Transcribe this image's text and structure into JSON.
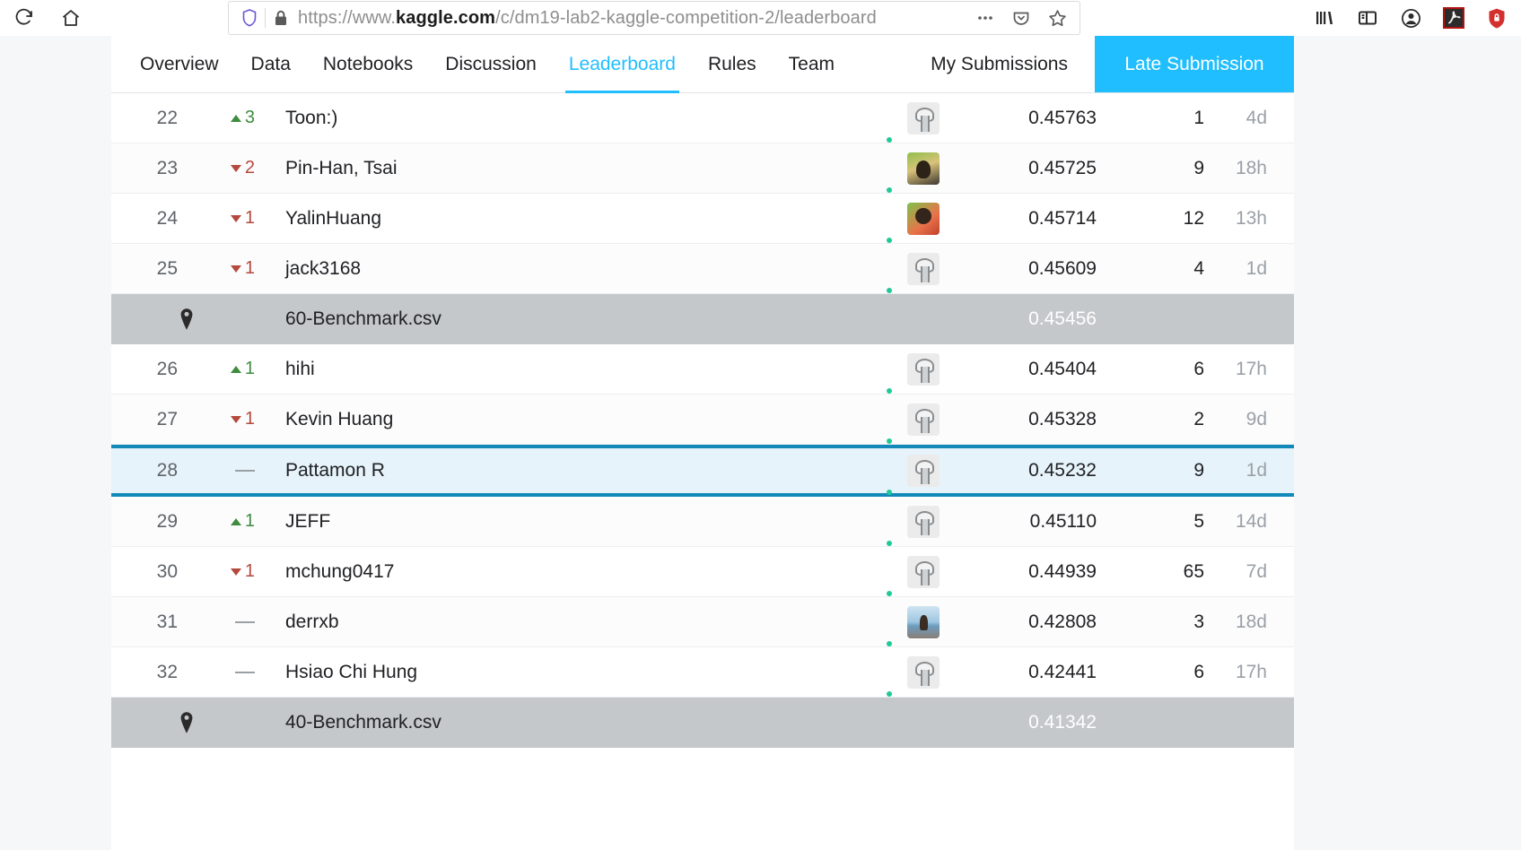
{
  "browser": {
    "reload_icon": "reload-icon",
    "home_icon": "home-icon",
    "shield_icon": "shield-icon",
    "lock_icon": "lock-icon",
    "url_scheme": "https://www.",
    "url_host": "kaggle.com",
    "url_path": "/c/dm19-lab2-kaggle-competition-2/leaderboard",
    "url_full": "https://www.kaggle.com/c/dm19-lab2-kaggle-competition-2/leaderboard",
    "page_actions_icon": "ellipsis-icon",
    "pocket_icon": "pocket-icon",
    "bookmark_icon": "star-icon",
    "toolbar_icons": [
      "library-icon",
      "sidebar-icon",
      "account-icon",
      "adobe-acrobat-icon",
      "shield-extension-icon"
    ]
  },
  "nav": {
    "tabs": [
      {
        "label": "Overview",
        "active": false
      },
      {
        "label": "Data",
        "active": false
      },
      {
        "label": "Notebooks",
        "active": false
      },
      {
        "label": "Discussion",
        "active": false
      },
      {
        "label": "Leaderboard",
        "active": true
      },
      {
        "label": "Rules",
        "active": false
      },
      {
        "label": "Team",
        "active": false
      }
    ],
    "my_submissions": "My Submissions",
    "late_submission": "Late Submission",
    "accent_color": "#20beff"
  },
  "leaderboard": {
    "highlight_border_color": "#1389ba",
    "highlight_bg_color": "#e6f3fa",
    "benchmark_bg_color": "#c4c8cb",
    "pin_icon": "map-pin-icon",
    "rows": [
      {
        "type": "team",
        "rank": "22",
        "delta": "3",
        "direction": "up",
        "name": "Toon:)",
        "avatar": "goose",
        "score": "0.45763",
        "entries": "1",
        "time": "4d"
      },
      {
        "type": "team",
        "rank": "23",
        "delta": "2",
        "direction": "down",
        "name": "Pin-Han, Tsai",
        "avatar": "photo-a",
        "score": "0.45725",
        "entries": "9",
        "time": "18h"
      },
      {
        "type": "team",
        "rank": "24",
        "delta": "1",
        "direction": "down",
        "name": "YalinHuang",
        "avatar": "photo-b",
        "score": "0.45714",
        "entries": "12",
        "time": "13h"
      },
      {
        "type": "team",
        "rank": "25",
        "delta": "1",
        "direction": "down",
        "name": "jack3168",
        "avatar": "goose",
        "score": "0.45609",
        "entries": "4",
        "time": "1d"
      },
      {
        "type": "benchmark",
        "name": "60-Benchmark.csv",
        "score": "0.45456"
      },
      {
        "type": "team",
        "rank": "26",
        "delta": "1",
        "direction": "up",
        "name": "hihi",
        "avatar": "goose",
        "score": "0.45404",
        "entries": "6",
        "time": "17h"
      },
      {
        "type": "team",
        "rank": "27",
        "delta": "1",
        "direction": "down",
        "name": "Kevin Huang",
        "avatar": "goose",
        "score": "0.45328",
        "entries": "2",
        "time": "9d"
      },
      {
        "type": "you",
        "rank": "28",
        "delta": "",
        "direction": "flat",
        "name": "Pattamon R",
        "avatar": "goose",
        "score": "0.45232",
        "entries": "9",
        "time": "1d"
      },
      {
        "type": "team",
        "rank": "29",
        "delta": "1",
        "direction": "up",
        "name": "JEFF",
        "avatar": "goose",
        "score": "0.45110",
        "entries": "5",
        "time": "14d"
      },
      {
        "type": "team",
        "rank": "30",
        "delta": "1",
        "direction": "down",
        "name": "mchung0417",
        "avatar": "goose",
        "score": "0.44939",
        "entries": "65",
        "time": "7d"
      },
      {
        "type": "team",
        "rank": "31",
        "delta": "",
        "direction": "flat",
        "name": "derrxb",
        "avatar": "photo-c",
        "score": "0.42808",
        "entries": "3",
        "time": "18d"
      },
      {
        "type": "team",
        "rank": "32",
        "delta": "",
        "direction": "flat",
        "name": "Hsiao Chi Hung",
        "avatar": "goose",
        "score": "0.42441",
        "entries": "6",
        "time": "17h"
      },
      {
        "type": "benchmark",
        "name": "40-Benchmark.csv",
        "score": "0.41342"
      }
    ]
  }
}
